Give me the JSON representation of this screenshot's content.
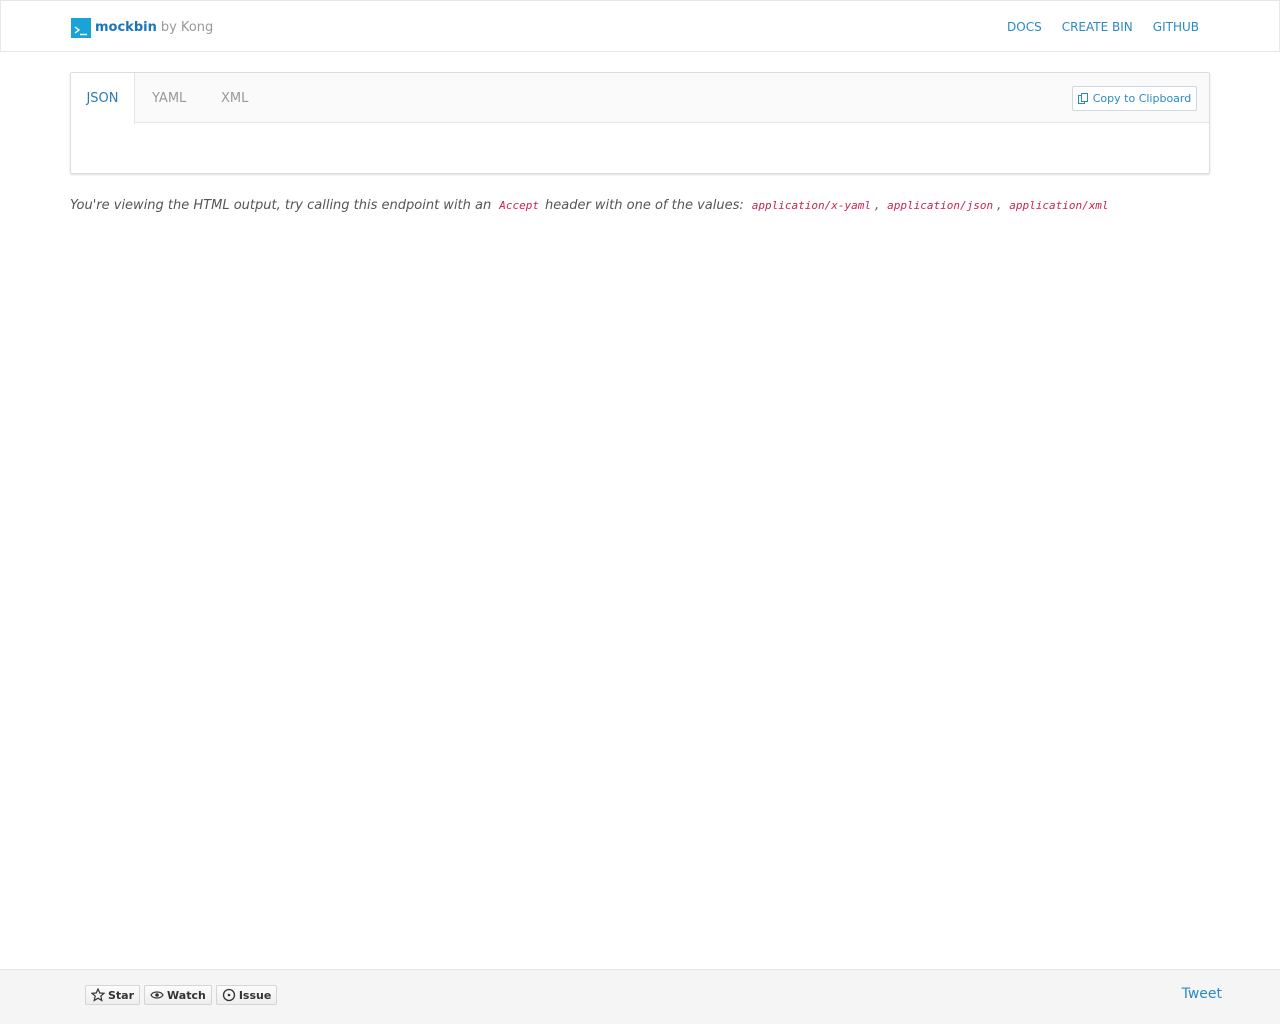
{
  "brand": {
    "name": "mockbin",
    "by": "by Kong",
    "logo_icon": "terminal-icon"
  },
  "nav": {
    "links": [
      "DOCS",
      "CREATE BIN",
      "GITHUB"
    ]
  },
  "panel": {
    "tabs": [
      "JSON",
      "YAML",
      "XML"
    ],
    "active_tab": "JSON",
    "copy_label": "Copy to Clipboard",
    "copy_icon": "copy-icon"
  },
  "info": {
    "prefix": "You're viewing the HTML output, try calling this endpoint with an",
    "header_name": "Accept",
    "middle": "header with one of the values:",
    "values": [
      "application/x-yaml",
      "application/json",
      "application/xml"
    ],
    "separator": ","
  },
  "footer": {
    "github_buttons": [
      {
        "label": "Star",
        "icon": "star-icon"
      },
      {
        "label": "Watch",
        "icon": "eye-icon"
      },
      {
        "label": "Issue",
        "icon": "issue-icon"
      }
    ],
    "tweet_label": "Tweet"
  },
  "colors": {
    "accent": "#2a8ac4",
    "logo_bg": "#1aa3d8",
    "code": "#c7254e"
  }
}
